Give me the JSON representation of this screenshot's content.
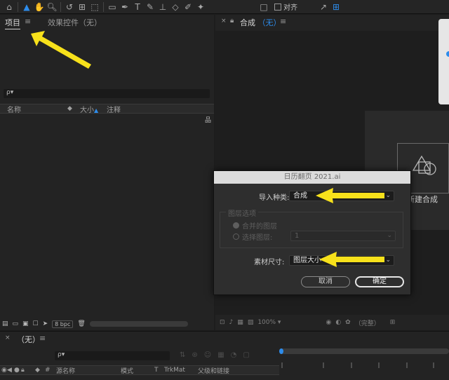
{
  "toolbar": {
    "align_label": "对齐"
  },
  "project_panel": {
    "tab_project": "项目",
    "tab_menu": "≡",
    "tab_effects": "效果控件（无）",
    "search_placeholder": "ρ▾",
    "columns": {
      "name": "名称",
      "size": "大小",
      "comment": "注释"
    },
    "footer": {
      "bpc": "8 bpc"
    }
  },
  "comp_panel": {
    "tab_label": "合成",
    "tab_value": "（无）",
    "tab_menu": "≡",
    "new_comp_label": "新建合成",
    "zoom": "100%",
    "quality": "（完整）"
  },
  "dialog": {
    "title": "日历翻页 2021.ai",
    "import_kind_label": "导入种类:",
    "import_kind_value": "合成",
    "layer_options_label": "图层选项",
    "merged_layers": "合并的图层",
    "choose_layer": "选择图层:",
    "choose_layer_value": "1",
    "footage_size_label": "素材尺寸:",
    "footage_size_value": "图层大小",
    "cancel": "取消",
    "ok": "确定"
  },
  "timeline": {
    "tab_label": "（无）",
    "tab_menu": "≡",
    "search_placeholder": "ρ▾",
    "columns": {
      "hash": "#",
      "source_name": "源名称",
      "mode": "模式",
      "t": "T",
      "trkmat": "TrkMat",
      "parent": "父级和链接"
    }
  },
  "colors": {
    "accent": "#2d8ceb",
    "annotation_arrow": "#f7e11b"
  }
}
